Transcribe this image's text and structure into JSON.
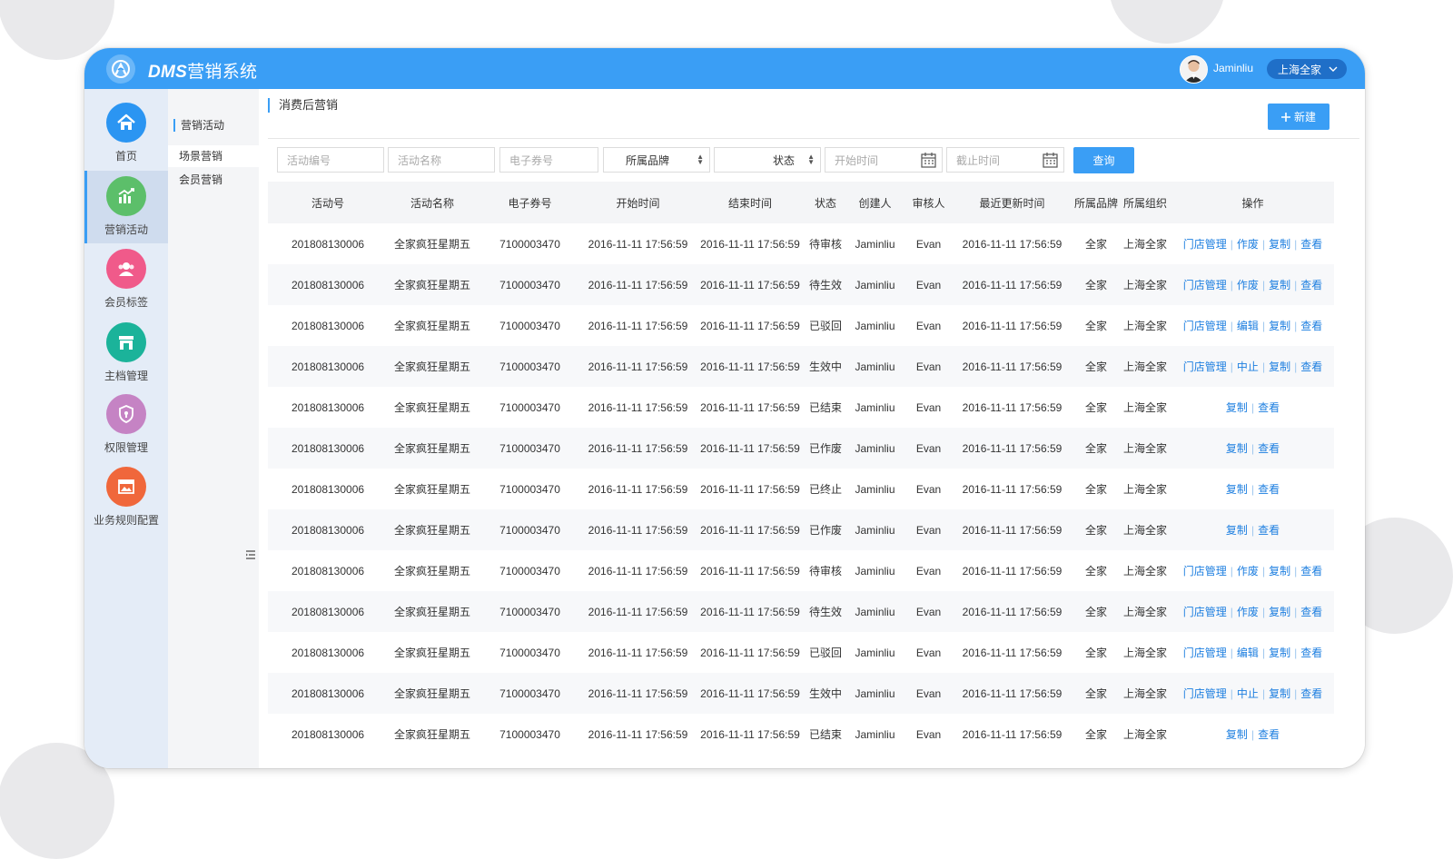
{
  "app": {
    "title_en": "DMS",
    "title_cn": "营销系统"
  },
  "user": {
    "name": "Jaminliu",
    "org": "上海全家"
  },
  "nav": [
    {
      "label": "首页",
      "icon": "home-icon",
      "color": "#2b95f2"
    },
    {
      "label": "营销活动",
      "icon": "chart-icon",
      "color": "#5cbf6a",
      "active": true
    },
    {
      "label": "会员标签",
      "icon": "users-icon",
      "color": "#f05a8a"
    },
    {
      "label": "主档管理",
      "icon": "store-icon",
      "color": "#1bb39a"
    },
    {
      "label": "权限管理",
      "icon": "shield-icon",
      "color": "#c583c4"
    },
    {
      "label": "业务规则配置",
      "icon": "gallery-icon",
      "color": "#f0673b"
    }
  ],
  "subnav": {
    "title": "营销活动",
    "items": [
      {
        "label": "场景营销",
        "active": true
      },
      {
        "label": "会员营销"
      }
    ]
  },
  "page": {
    "title": "消费后营销",
    "new_label": "新建"
  },
  "filters": {
    "activity_id": "活动编号",
    "activity_name": "活动名称",
    "coupon_no": "电子券号",
    "brand": "所属品牌",
    "status": "状态",
    "start_time": "开始时间",
    "end_time": "截止时间",
    "query_label": "查询"
  },
  "table": {
    "headers": [
      "活动号",
      "活动名称",
      "电子券号",
      "开始时间",
      "结束时间",
      "状态",
      "创建人",
      "审核人",
      "最近更新时间",
      "所属品牌",
      "所属组织",
      "操作"
    ],
    "rows": [
      {
        "id": "201808130006",
        "name": "全家疯狂星期五",
        "coupon": "7100003470",
        "start": "2016-11-11 17:56:59",
        "end": "2016-11-11 17:56:59",
        "status": "待审核",
        "creator": "Jaminliu",
        "reviewer": "Evan",
        "updated": "2016-11-11 17:56:59",
        "brand": "全家",
        "org": "上海全家",
        "ops": [
          "门店管理",
          "作废",
          "复制",
          "查看"
        ]
      },
      {
        "id": "201808130006",
        "name": "全家疯狂星期五",
        "coupon": "7100003470",
        "start": "2016-11-11 17:56:59",
        "end": "2016-11-11 17:56:59",
        "status": "待生效",
        "creator": "Jaminliu",
        "reviewer": "Evan",
        "updated": "2016-11-11 17:56:59",
        "brand": "全家",
        "org": "上海全家",
        "ops": [
          "门店管理",
          "作废",
          "复制",
          "查看"
        ]
      },
      {
        "id": "201808130006",
        "name": "全家疯狂星期五",
        "coupon": "7100003470",
        "start": "2016-11-11 17:56:59",
        "end": "2016-11-11 17:56:59",
        "status": "已驳回",
        "creator": "Jaminliu",
        "reviewer": "Evan",
        "updated": "2016-11-11 17:56:59",
        "brand": "全家",
        "org": "上海全家",
        "ops": [
          "门店管理",
          "编辑",
          "复制",
          "查看"
        ]
      },
      {
        "id": "201808130006",
        "name": "全家疯狂星期五",
        "coupon": "7100003470",
        "start": "2016-11-11 17:56:59",
        "end": "2016-11-11 17:56:59",
        "status": "生效中",
        "creator": "Jaminliu",
        "reviewer": "Evan",
        "updated": "2016-11-11 17:56:59",
        "brand": "全家",
        "org": "上海全家",
        "ops": [
          "门店管理",
          "中止",
          "复制",
          "查看"
        ]
      },
      {
        "id": "201808130006",
        "name": "全家疯狂星期五",
        "coupon": "7100003470",
        "start": "2016-11-11 17:56:59",
        "end": "2016-11-11 17:56:59",
        "status": "已结束",
        "creator": "Jaminliu",
        "reviewer": "Evan",
        "updated": "2016-11-11 17:56:59",
        "brand": "全家",
        "org": "上海全家",
        "ops": [
          "复制",
          "查看"
        ]
      },
      {
        "id": "201808130006",
        "name": "全家疯狂星期五",
        "coupon": "7100003470",
        "start": "2016-11-11 17:56:59",
        "end": "2016-11-11 17:56:59",
        "status": "已作废",
        "creator": "Jaminliu",
        "reviewer": "Evan",
        "updated": "2016-11-11 17:56:59",
        "brand": "全家",
        "org": "上海全家",
        "ops": [
          "复制",
          "查看"
        ]
      },
      {
        "id": "201808130006",
        "name": "全家疯狂星期五",
        "coupon": "7100003470",
        "start": "2016-11-11 17:56:59",
        "end": "2016-11-11 17:56:59",
        "status": "已终止",
        "creator": "Jaminliu",
        "reviewer": "Evan",
        "updated": "2016-11-11 17:56:59",
        "brand": "全家",
        "org": "上海全家",
        "ops": [
          "复制",
          "查看"
        ]
      },
      {
        "id": "201808130006",
        "name": "全家疯狂星期五",
        "coupon": "7100003470",
        "start": "2016-11-11 17:56:59",
        "end": "2016-11-11 17:56:59",
        "status": "已作废",
        "creator": "Jaminliu",
        "reviewer": "Evan",
        "updated": "2016-11-11 17:56:59",
        "brand": "全家",
        "org": "上海全家",
        "ops": [
          "复制",
          "查看"
        ]
      },
      {
        "id": "201808130006",
        "name": "全家疯狂星期五",
        "coupon": "7100003470",
        "start": "2016-11-11 17:56:59",
        "end": "2016-11-11 17:56:59",
        "status": "待审核",
        "creator": "Jaminliu",
        "reviewer": "Evan",
        "updated": "2016-11-11 17:56:59",
        "brand": "全家",
        "org": "上海全家",
        "ops": [
          "门店管理",
          "作废",
          "复制",
          "查看"
        ]
      },
      {
        "id": "201808130006",
        "name": "全家疯狂星期五",
        "coupon": "7100003470",
        "start": "2016-11-11 17:56:59",
        "end": "2016-11-11 17:56:59",
        "status": "待生效",
        "creator": "Jaminliu",
        "reviewer": "Evan",
        "updated": "2016-11-11 17:56:59",
        "brand": "全家",
        "org": "上海全家",
        "ops": [
          "门店管理",
          "作废",
          "复制",
          "查看"
        ]
      },
      {
        "id": "201808130006",
        "name": "全家疯狂星期五",
        "coupon": "7100003470",
        "start": "2016-11-11 17:56:59",
        "end": "2016-11-11 17:56:59",
        "status": "已驳回",
        "creator": "Jaminliu",
        "reviewer": "Evan",
        "updated": "2016-11-11 17:56:59",
        "brand": "全家",
        "org": "上海全家",
        "ops": [
          "门店管理",
          "编辑",
          "复制",
          "查看"
        ]
      },
      {
        "id": "201808130006",
        "name": "全家疯狂星期五",
        "coupon": "7100003470",
        "start": "2016-11-11 17:56:59",
        "end": "2016-11-11 17:56:59",
        "status": "生效中",
        "creator": "Jaminliu",
        "reviewer": "Evan",
        "updated": "2016-11-11 17:56:59",
        "brand": "全家",
        "org": "上海全家",
        "ops": [
          "门店管理",
          "中止",
          "复制",
          "查看"
        ]
      },
      {
        "id": "201808130006",
        "name": "全家疯狂星期五",
        "coupon": "7100003470",
        "start": "2016-11-11 17:56:59",
        "end": "2016-11-11 17:56:59",
        "status": "已结束",
        "creator": "Jaminliu",
        "reviewer": "Evan",
        "updated": "2016-11-11 17:56:59",
        "brand": "全家",
        "org": "上海全家",
        "ops": [
          "复制",
          "查看"
        ]
      }
    ]
  },
  "colors": {
    "primary": "#3a9ef5",
    "link": "#1e7fe0",
    "nav_bg": "#e4ecf7"
  }
}
